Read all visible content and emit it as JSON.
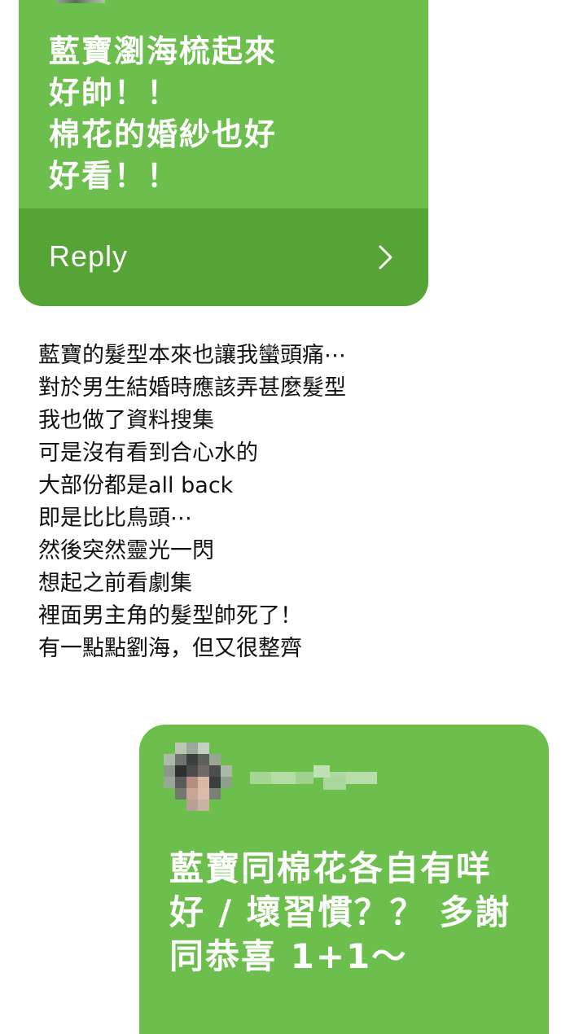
{
  "top_card": {
    "message": "藍寶瀏海梳起來\n好帥！！\n棉花的婚紗也好\n好看！！",
    "reply_label": "Reply",
    "reply_icon": "chevron-right-icon"
  },
  "body_text": "藍寶的髮型本來也讓我蠻頭痛⋯\n對於男生結婚時應該弄甚麼髮型\n我也做了資料搜集\n可是沒有看到合心水的\n大部份都是all back\n即是比比鳥頭⋯\n然後突然靈光一閃\n想起之前看劇集\n裡面男主角的髮型帥死了！\n有一點點劉海，但又很整齊",
  "bottom_card": {
    "avatar_icon": "pixelated-avatar",
    "username_icon": "pixelated-username",
    "message": "藍寶同棉花各自有咩\n好 / 壞習慣？？ 多謝\n同恭喜 1+1～"
  },
  "colors": {
    "card_green": "#6cbf4d",
    "reply_bar_green": "#56a436",
    "text_on_card": "#ffffff",
    "body_text": "#111111",
    "background": "#ffffff"
  }
}
